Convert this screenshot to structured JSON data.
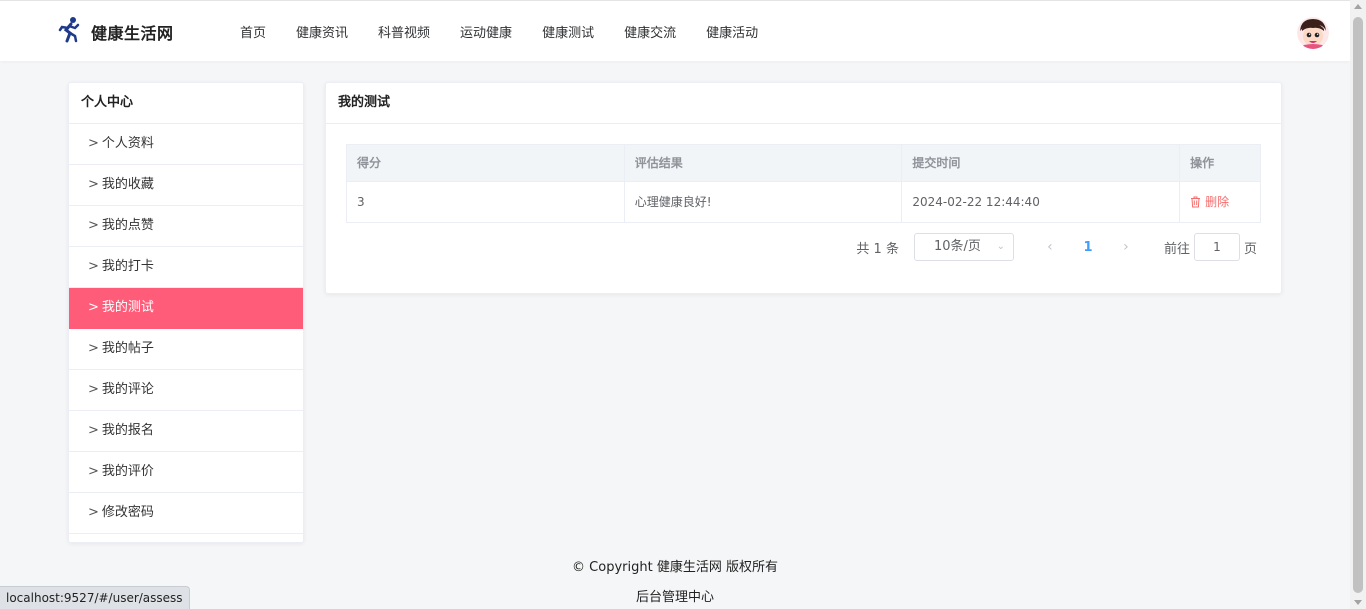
{
  "header": {
    "site_title": "健康生活网",
    "nav": [
      "首页",
      "健康资讯",
      "科普视频",
      "运动健康",
      "健康测试",
      "健康交流",
      "健康活动"
    ],
    "logo_icon": "runner-icon",
    "avatar_icon": "user-avatar"
  },
  "sidebar": {
    "title": "个人中心",
    "items": [
      "个人资料",
      "我的收藏",
      "我的点赞",
      "我的打卡",
      "我的测试",
      "我的帖子",
      "我的评论",
      "我的报名",
      "我的评价",
      "修改密码"
    ],
    "active_item": "我的测试",
    "chevron": ">"
  },
  "main": {
    "title": "我的测试",
    "table": {
      "columns": [
        "得分",
        "评估结果",
        "提交时间",
        "操作"
      ],
      "rows": [
        {
          "score": "3",
          "result": "心理健康良好!",
          "time": "2024-02-22 12:44:40",
          "action": "删除"
        }
      ]
    },
    "pagination": {
      "total": "共 1 条",
      "page_size": "10条/页",
      "current_page": "1",
      "goto_label": "前往",
      "goto_value": "1",
      "page_suffix": "页"
    }
  },
  "footer": {
    "copyright": "© Copyright 健康生活网 版权所有",
    "admin_link": "后台管理中心"
  },
  "status_bar": {
    "url": "localhost:9527/#/user/assess"
  },
  "colors": {
    "accent": "#ff5c7a",
    "link": "#409eff",
    "danger": "#f56c6c"
  }
}
